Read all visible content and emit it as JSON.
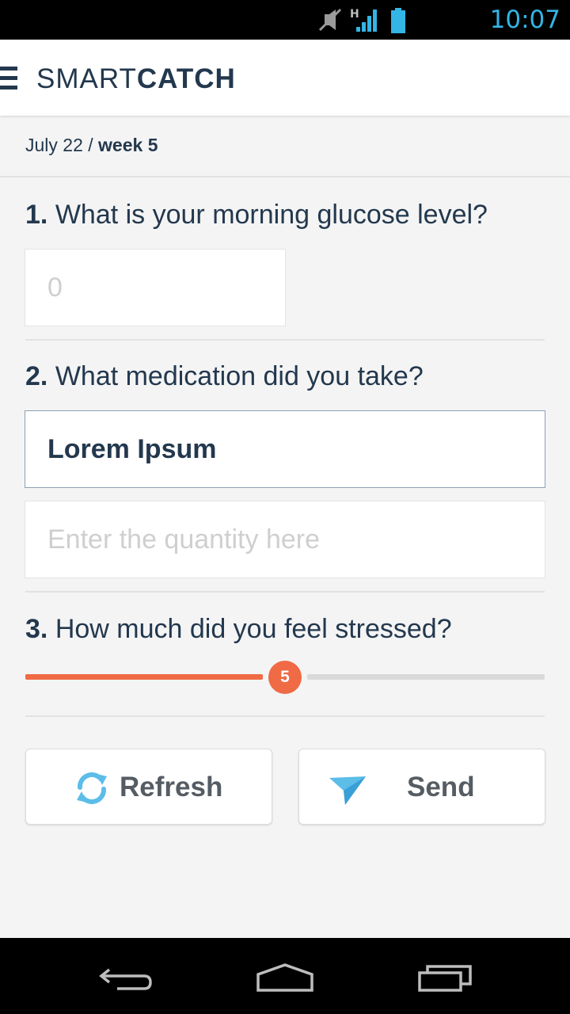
{
  "status_bar": {
    "time": "10:07",
    "icons": [
      "mute-icon",
      "signal-h-icon",
      "battery-icon"
    ]
  },
  "app_bar": {
    "menu_icon": "hamburger-menu-icon",
    "logo_light": "SMART",
    "logo_bold": "CATCH"
  },
  "breadcrumb": {
    "date": "July 22",
    "separator": " / ",
    "week": "week 5"
  },
  "questions": [
    {
      "number": "1.",
      "text": "What is your morning glucose level?"
    },
    {
      "number": "2.",
      "text": "What medication did you take?"
    },
    {
      "number": "3.",
      "text": "How much did you feel stressed?"
    }
  ],
  "glucose_input": {
    "placeholder": "0",
    "value": ""
  },
  "medication_input": {
    "value": "Lorem Ipsum"
  },
  "quantity_input": {
    "placeholder": "Enter the quantity here",
    "value": ""
  },
  "stress_slider": {
    "value": "5",
    "min": 0,
    "max": 10,
    "fill_fraction": 0.5
  },
  "buttons": {
    "refresh_label": "Refresh",
    "refresh_icon": "refresh-icon",
    "send_label": "Send",
    "send_icon": "paper-plane-icon"
  },
  "colors": {
    "accent": "#ef6a45",
    "brand_dark": "#23384e",
    "icon_blue": "#5bbde8"
  },
  "nav_bar": [
    "back-icon",
    "home-icon",
    "recent-apps-icon"
  ]
}
